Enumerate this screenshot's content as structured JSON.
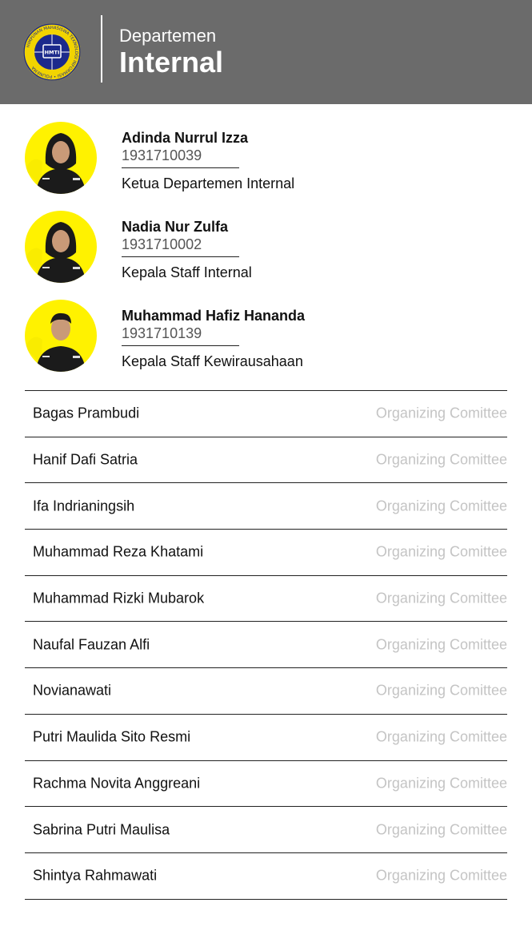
{
  "header": {
    "subtitle": "Departemen",
    "title": "Internal",
    "logo_text": "HMTI",
    "logo_ring_text": "HIMPUNAN MAHASISWA TEKNOLOGI INFORMASI",
    "logo_bottom_text": "POLINEMA"
  },
  "colors": {
    "header_bg": "#6b6b6b",
    "avatar_bg": "#fff200",
    "role_text": "#c4c4c4"
  },
  "leaders": [
    {
      "name": "Adinda Nurrul Izza",
      "nim": "1931710039",
      "role": "Ketua Departemen Internal",
      "hijab": true
    },
    {
      "name": "Nadia Nur Zulfa",
      "nim": "1931710002",
      "role": "Kepala Staff Internal",
      "hijab": true
    },
    {
      "name": "Muhammad Hafiz Hananda",
      "nim": "1931710139",
      "role": "Kepala Staff Kewirausahaan",
      "hijab": false
    }
  ],
  "members": [
    {
      "name": "Bagas Prambudi",
      "role": "Organizing Comittee"
    },
    {
      "name": "Hanif Dafi Satria",
      "role": "Organizing Comittee"
    },
    {
      "name": "Ifa Indrianingsih",
      "role": "Organizing Comittee"
    },
    {
      "name": "Muhammad Reza Khatami",
      "role": "Organizing Comittee"
    },
    {
      "name": "Muhammad Rizki Mubarok",
      "role": "Organizing Comittee"
    },
    {
      "name": "Naufal Fauzan Alfi",
      "role": "Organizing Comittee"
    },
    {
      "name": "Novianawati",
      "role": "Organizing Comittee"
    },
    {
      "name": "Putri Maulida Sito Resmi",
      "role": "Organizing Comittee"
    },
    {
      "name": "Rachma Novita Anggreani",
      "role": "Organizing Comittee"
    },
    {
      "name": "Sabrina Putri Maulisa",
      "role": "Organizing Comittee"
    },
    {
      "name": "Shintya Rahmawati",
      "role": "Organizing Comittee"
    }
  ]
}
